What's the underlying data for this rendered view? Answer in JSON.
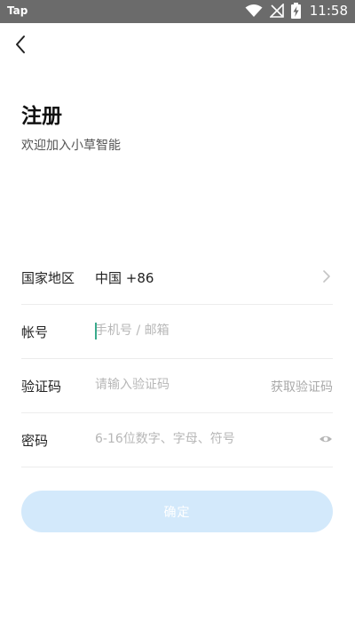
{
  "status_bar": {
    "app_name": "Tap",
    "time": "11:58"
  },
  "header": {
    "title": "注册",
    "subtitle": "欢迎加入小草智能"
  },
  "form": {
    "region": {
      "label": "国家地区",
      "value": "中国 +86"
    },
    "account": {
      "label": "帐号",
      "placeholder": "手机号 / 邮箱"
    },
    "code": {
      "label": "验证码",
      "placeholder": "请输入验证码",
      "action": "获取验证码"
    },
    "password": {
      "label": "密码",
      "placeholder": "6-16位数字、字母、符号"
    }
  },
  "confirm_button": {
    "label": "确定"
  },
  "colors": {
    "button_bg": "#d3e9fb",
    "cursor": "#3aaa8c",
    "status_bar": "#6b6b6b"
  },
  "icons": [
    "back-arrow-icon",
    "wifi-icon",
    "no-signal-icon",
    "battery-charging-icon",
    "chevron-right-icon",
    "eye-icon"
  ]
}
